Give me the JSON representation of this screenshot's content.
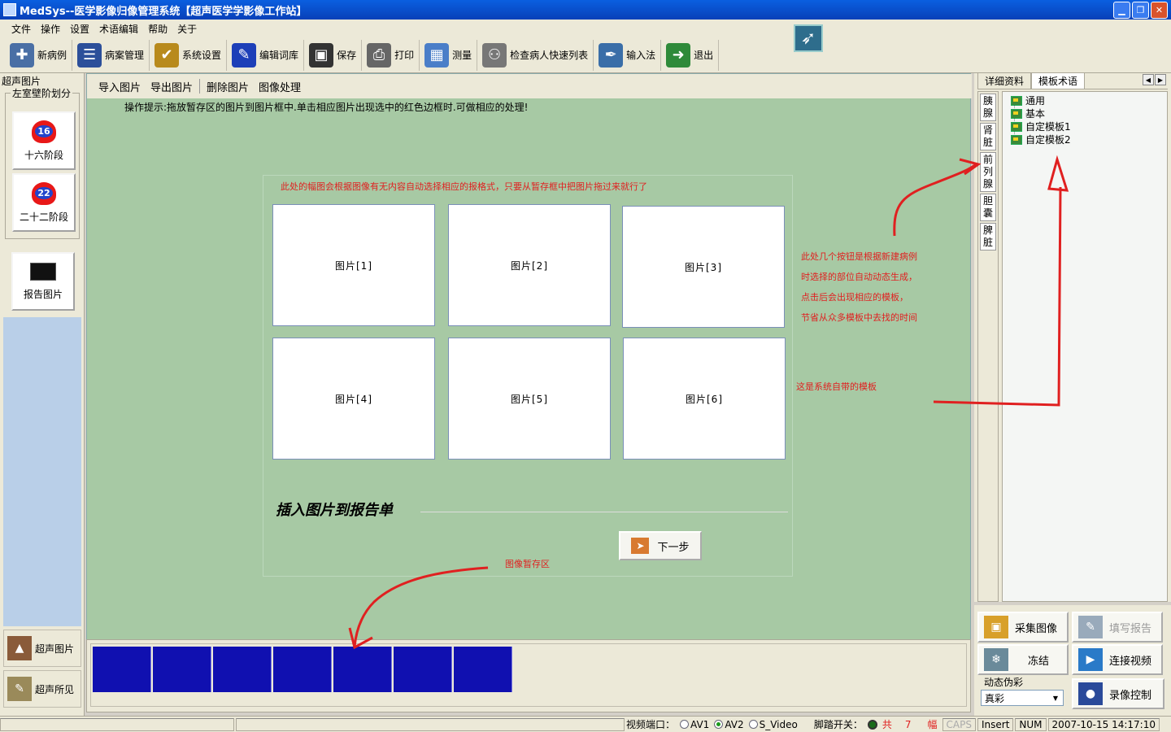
{
  "window": {
    "title": "MedSys--医学影像归像管理系统【超声医学学影像工作站】"
  },
  "menu": [
    "文件",
    "操作",
    "设置",
    "术语编辑",
    "帮助",
    "关于"
  ],
  "toolbar": [
    {
      "label": "新病例",
      "icon": "new-case-icon",
      "color": "#4a6fa5"
    },
    {
      "label": "病案管理",
      "icon": "records-icon",
      "color": "#2c4f9a"
    },
    {
      "label": "系统设置",
      "icon": "settings-icon",
      "color": "#b88a1c"
    },
    {
      "label": "编辑词库",
      "icon": "dictionary-icon",
      "color": "#1d3fb8"
    },
    {
      "label": "保存",
      "icon": "save-icon",
      "color": "#333333"
    },
    {
      "label": "打印",
      "icon": "print-icon",
      "color": "#666666"
    },
    {
      "label": "测量",
      "icon": "measure-icon",
      "color": "#4a7ec8"
    },
    {
      "label": "检查病人快速列表",
      "icon": "patient-list-icon",
      "color": "#777777"
    },
    {
      "label": "输入法",
      "icon": "input-method-icon",
      "color": "#3a6ea8"
    },
    {
      "label": "退出",
      "icon": "exit-icon",
      "color": "#2f8a3a"
    }
  ],
  "left": {
    "panel_title": "超声图片",
    "group_title": "左室壁阶划分",
    "stage16": {
      "badge": "16",
      "label": "十六阶段"
    },
    "stage22": {
      "badge": "22",
      "label": "二十二阶段"
    },
    "report_image": "报告图片",
    "bottom_nav": [
      "超声图片",
      "超声所见"
    ]
  },
  "main": {
    "subtoolbar": [
      "导入图片",
      "导出图片",
      "删除图片",
      "图像处理"
    ],
    "hint": "操作提示:拖放暂存区的图片到图片框中.单击相应图片出现选中的红色边框时.可做相应的处理!",
    "note_top": "此处的幅图会根据图像有无内容自动选择相应的报格式，只要从暂存框中把图片拖过来就行了",
    "slots": [
      "图片[1]",
      "图片[2]",
      "图片[3]",
      "图片[4]",
      "图片[5]",
      "图片[6]"
    ],
    "insert_title": "插入图片到报告单",
    "next_button": "下一步",
    "note_side": [
      "此处几个按钮是根据新建病例",
      "时选择的部位自动动态生成，",
      "点击后会出现相应的模板，",
      "节省从众多模板中去找的时间"
    ],
    "note_system": "这是系统自带的模板",
    "note_temp": "图像暂存区"
  },
  "strip": {
    "cells": 7,
    "color": "#1010b0"
  },
  "right": {
    "tabs": [
      "详细资料",
      "模板术语"
    ],
    "active_tab": 1,
    "organs": [
      "胰腺",
      "肾脏",
      "前列腺",
      "胆囊",
      "脾脏"
    ],
    "tree": [
      "通用",
      "基本",
      "自定模板1",
      "自定模板2"
    ]
  },
  "controls": {
    "capture": "采集图像",
    "fill_report": "填写报告",
    "freeze": "冻结",
    "connect_video": "连接视频",
    "dynamic_label": "动态伪彩",
    "dynamic_value": "真彩",
    "record_control": "录像控制"
  },
  "status": {
    "video_port_label": "视频端口：",
    "ports": [
      "AV1",
      "AV2",
      "S_Video"
    ],
    "selected_port": "AV2",
    "pedal_label": "脚踏开关：",
    "count_prefix": "共",
    "count": "7",
    "count_suffix": "幅",
    "caps": "CAPS",
    "insert": "Insert",
    "num": "NUM",
    "datetime": "2007-10-15  14:17:10"
  },
  "colors": {
    "workarea": "#a7c9a4",
    "annotation": "#e02020",
    "strip": "#1010b0"
  }
}
